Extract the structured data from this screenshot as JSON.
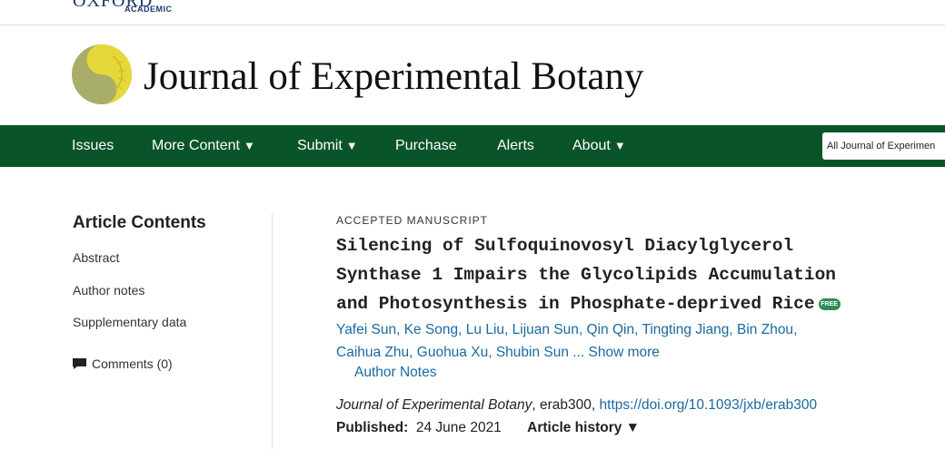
{
  "publisher": {
    "name": "OXFORD",
    "sub": "ACADEMIC"
  },
  "journal": {
    "title": "Journal of Experimental Botany",
    "logo_icon": "leaf-circle-logo-icon"
  },
  "nav": {
    "items": [
      {
        "label": "Issues",
        "dropdown": false
      },
      {
        "label": "More Content",
        "dropdown": true
      },
      {
        "label": "Submit",
        "dropdown": true
      },
      {
        "label": "Purchase",
        "dropdown": false
      },
      {
        "label": "Alerts",
        "dropdown": false
      },
      {
        "label": "About",
        "dropdown": true
      }
    ],
    "dropdown_arrow": "▼",
    "search_scope": "All Journal of Experimen"
  },
  "sidebar": {
    "heading": "Article Contents",
    "links": [
      "Abstract",
      "Author notes",
      "Supplementary data"
    ],
    "comments": "Comments (0)"
  },
  "article": {
    "type_label": "ACCEPTED MANUSCRIPT",
    "title_lines": [
      "Silencing of Sulfoquinovosyl Diacylglycerol",
      "Synthase 1 Impairs the Glycolipids Accumulation",
      "and Photosynthesis in Phosphate-deprived Rice"
    ],
    "free_badge": "FREE",
    "authors": [
      "Yafei Sun",
      "Ke Song",
      "Lu Liu",
      "Lijuan Sun",
      "Qin Qin",
      "Tingting Jiang",
      "Bin Zhou",
      "Caihua Zhu",
      "Guohua Xu",
      "Shubin Sun"
    ],
    "ellipsis": "...",
    "show_more": "Show more",
    "author_notes": "Author Notes",
    "citation_journal": "Journal of Experimental Botany",
    "citation_id": ", erab300, ",
    "doi": "https://doi.org/10.1093/jxb/erab300",
    "published_label": "Published:",
    "published_date": "24 June 2021",
    "history_label": "Article history",
    "history_arrow": "▼"
  },
  "colors": {
    "nav_bg": "#0a5429",
    "link": "#1a6aa0",
    "logo_yellow": "#e6d73a",
    "logo_olive": "#a8ae6a"
  }
}
